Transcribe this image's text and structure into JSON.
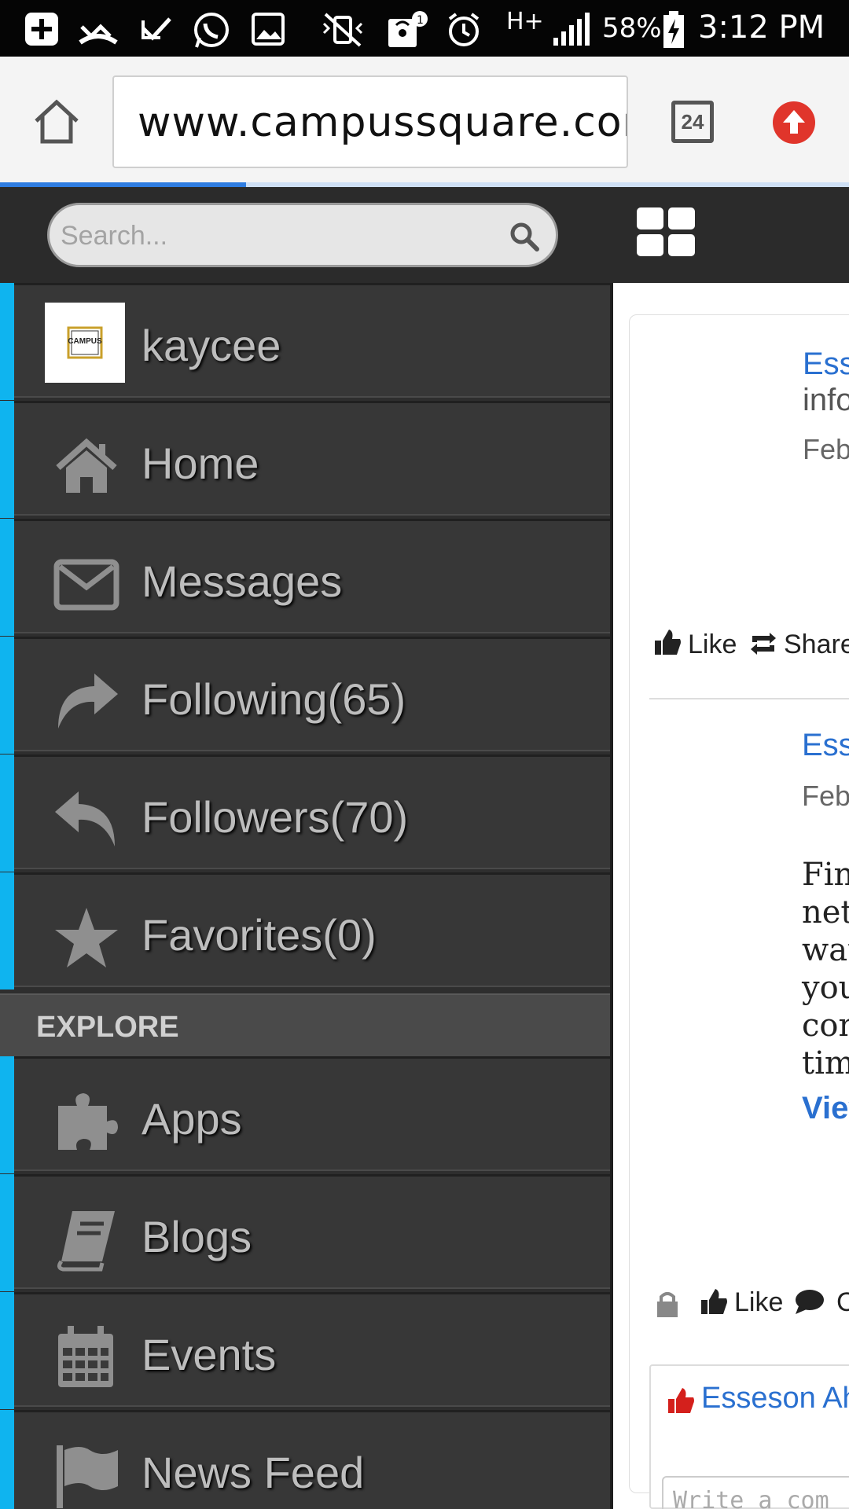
{
  "status_bar": {
    "battery": "58%",
    "time": "3:12 PM",
    "network": "H+",
    "notification_count": "1"
  },
  "browser": {
    "url": "www.campussquare.com.ng",
    "tab_count": "24",
    "load_progress": 0.29
  },
  "sidebar": {
    "search_placeholder": "Search...",
    "profile": {
      "name": "kaycee",
      "avatar_text": "CAMPUS"
    },
    "items": [
      {
        "label": "Home",
        "icon": "home-icon"
      },
      {
        "label": "Messages",
        "icon": "envelope-icon"
      },
      {
        "label": "Following(65)",
        "icon": "share-arrow-icon"
      },
      {
        "label": "Followers(70)",
        "icon": "reply-arrow-icon"
      },
      {
        "label": "Favorites(0)",
        "icon": "star-icon"
      }
    ],
    "section_title": "EXPLORE",
    "explore_items": [
      {
        "label": "Apps",
        "icon": "puzzle-icon"
      },
      {
        "label": "Blogs",
        "icon": "book-icon"
      },
      {
        "label": "Events",
        "icon": "calendar-icon"
      },
      {
        "label": "News Feed",
        "icon": "flag-icon"
      }
    ],
    "accent_color": "#0fb4ef"
  },
  "feed": {
    "post1": {
      "author": "Ess",
      "line": "info",
      "date": "Feb",
      "like": "Like",
      "share": "Share"
    },
    "post2": {
      "author": "Ess",
      "date": "Feb",
      "lines": [
        "Fin",
        "net",
        "wat",
        "you",
        "con",
        "tim"
      ],
      "view_more": "Viev",
      "like": "Like",
      "comment": "C"
    },
    "comment_box": {
      "liker": "Esseson Ah",
      "placeholder": "Write a com"
    }
  }
}
